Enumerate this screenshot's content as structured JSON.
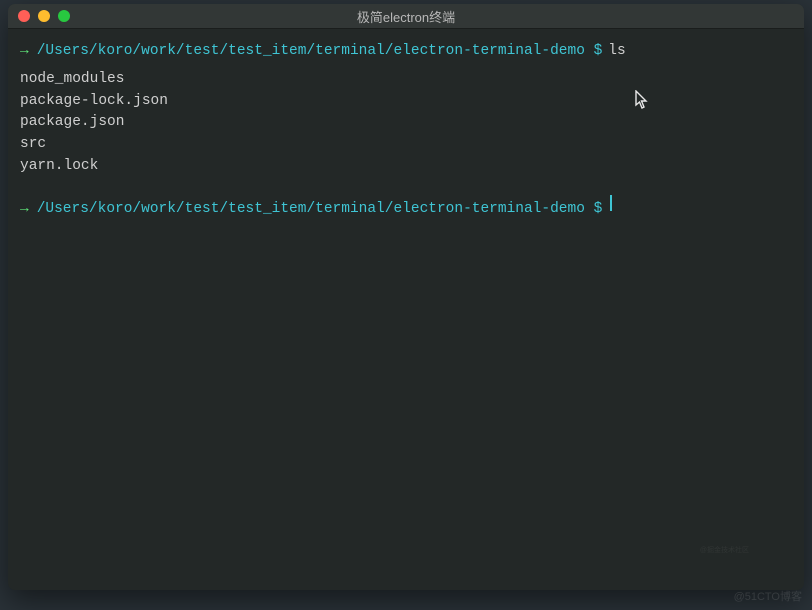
{
  "window": {
    "title": "极简electron终端"
  },
  "terminal": {
    "prompts": [
      {
        "arrow": "→",
        "path": "/Users/koro/work/test/test_item/terminal/electron-terminal-demo $",
        "command": "ls"
      },
      {
        "arrow": "→",
        "path": "/Users/koro/work/test/test_item/terminal/electron-terminal-demo $",
        "command": ""
      }
    ],
    "output": [
      "node_modules",
      "package-lock.json",
      "package.json",
      "src",
      "yarn.lock"
    ]
  },
  "watermark": "@51CTO博客",
  "watermark2": "@掘金技术社区",
  "colors": {
    "background": "#232827",
    "titlebar": "#323736",
    "arrow": "#5fe77a",
    "path": "#3fc5d4",
    "text": "#cfcfcf"
  }
}
